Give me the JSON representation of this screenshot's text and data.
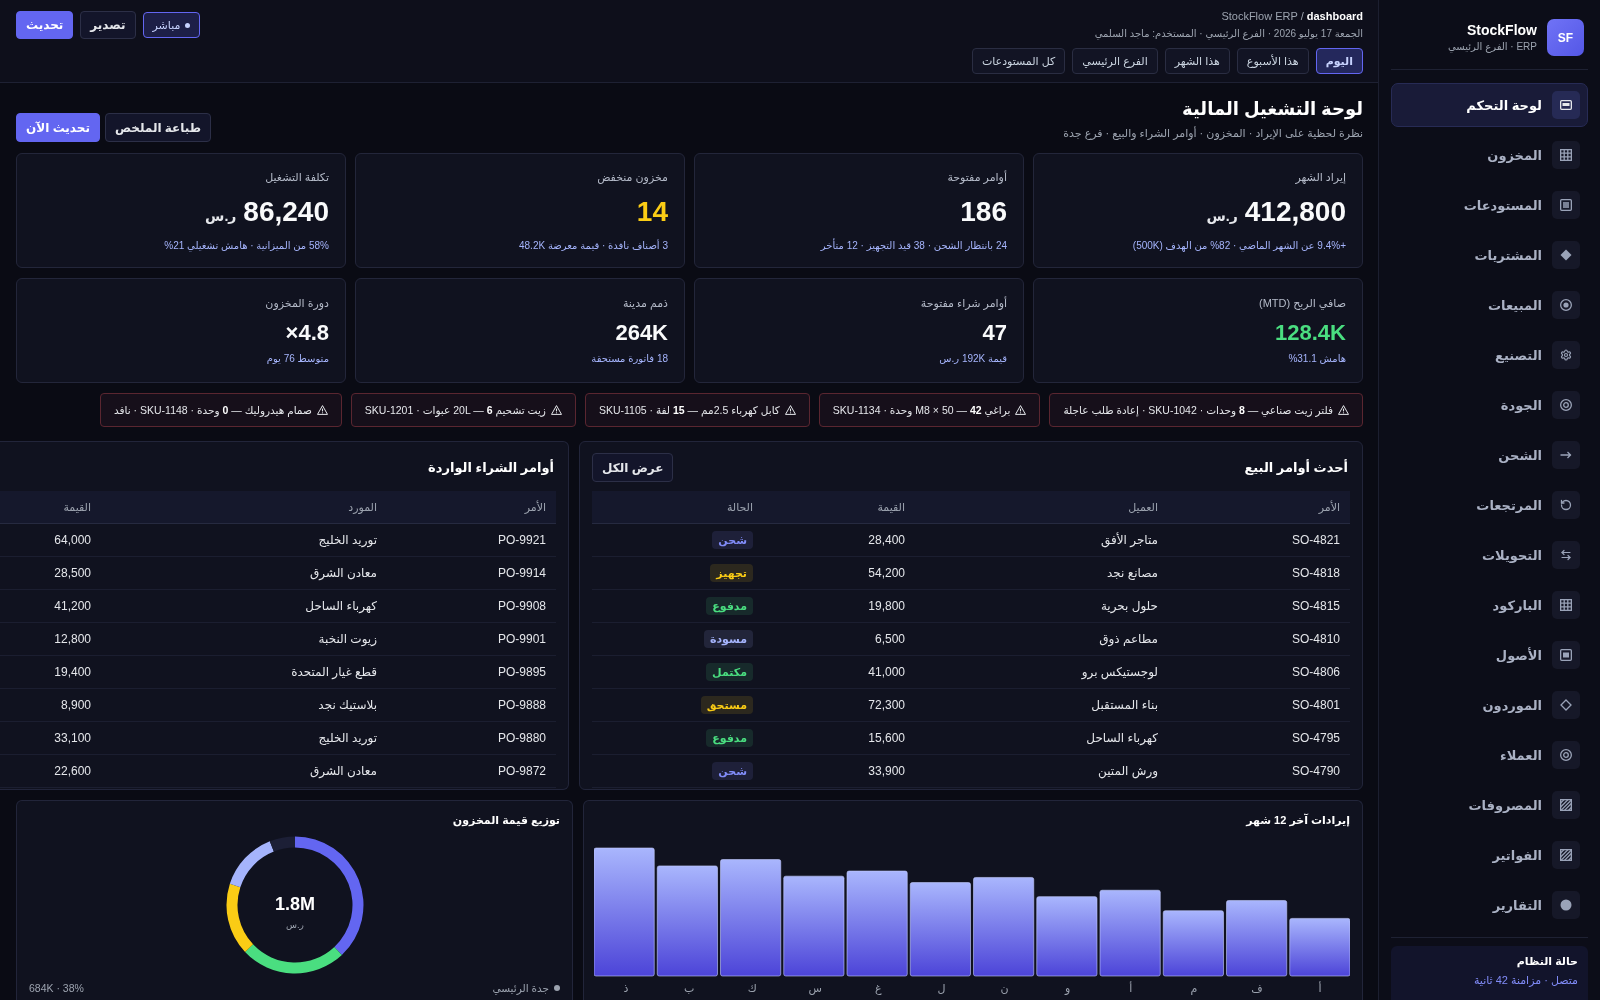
{
  "sidebar": {
    "logo": "SF",
    "brand": "StockFlow",
    "subtitle": "ERP · الفرع الرئيسي",
    "items": [
      {
        "label": "لوحة التحكم",
        "selected": true
      },
      {
        "label": "المخزون",
        "selected": false
      },
      {
        "label": "المستودعات",
        "selected": false
      },
      {
        "label": "المشتريات",
        "selected": false
      },
      {
        "label": "المبيعات",
        "selected": false
      },
      {
        "label": "التصنيع",
        "selected": false
      },
      {
        "label": "الجودة",
        "selected": false
      },
      {
        "label": "الشحن",
        "selected": false
      },
      {
        "label": "المرتجعات",
        "selected": false
      },
      {
        "label": "التحويلات",
        "selected": false
      },
      {
        "label": "الباركود",
        "selected": false
      },
      {
        "label": "الأصول",
        "selected": false
      },
      {
        "label": "الموردون",
        "selected": false
      },
      {
        "label": "العملاء",
        "selected": false
      },
      {
        "label": "المصروفات",
        "selected": false
      },
      {
        "label": "الفواتير",
        "selected": false
      },
      {
        "label": "التقارير",
        "selected": false
      }
    ],
    "status": {
      "title": "حالة النظام",
      "text": "متصل · مزامنة 42 ثانية"
    }
  },
  "header": {
    "breadcrumb": "StockFlow ERP / **dashboard**",
    "meta": "الجمعة 17 يوليو 2026 · الفرع الرئيسي · المستخدم: ماجد السلمي",
    "filters": [
      {
        "label": "اليوم",
        "selected": true
      },
      {
        "label": "هذا الأسبوع",
        "selected": false
      },
      {
        "label": "هذا الشهر",
        "selected": false
      },
      {
        "label": "الفرع الرئيسي",
        "selected": false
      },
      {
        "label": "كل المستودعات",
        "selected": false
      }
    ],
    "live_badge": "مباشر",
    "actions": [
      {
        "label": "تصدير",
        "kind": "secondary"
      },
      {
        "label": "تحديث",
        "kind": "primary"
      }
    ]
  },
  "page": {
    "title": "لوحة التشغيل المالية",
    "subtitle": "نظرة لحظية على الإيراد · المخزون · أوامر الشراء والبيع · فرع جدة",
    "actions": [
      {
        "label": "طباعة الملخص",
        "kind": "secondary"
      },
      {
        "label": "تحديث الآن",
        "kind": "primary"
      }
    ]
  },
  "kpis": [
    {
      "kind": "primary",
      "label": "إيراد الشهر",
      "value": "412,800",
      "unit": "ر.س",
      "color": "#f9fafb",
      "note": "+9.4% عن الشهر الماضي · 82% من الهدف (500K)"
    },
    {
      "kind": "primary",
      "label": "أوامر مفتوحة",
      "value": "186",
      "color": "#f9fafb",
      "note": "24 بانتظار الشحن · 38 قيد التجهيز · 12 متأخر"
    },
    {
      "kind": "primary",
      "label": "مخزون منخفض",
      "value": "14",
      "color": "#facc15",
      "note": "3 أصناف نافدة · قيمة معرضة 48.2K"
    },
    {
      "kind": "primary",
      "label": "تكلفة التشغيل",
      "value": "86,240",
      "unit": "ر.س",
      "color": "#f9fafb",
      "note": "58% من الميزانية · هامش تشغيلي 21%"
    },
    {
      "kind": "compact",
      "label": "صافي الربح (MTD)",
      "value": "128.4K",
      "color": "#4ade80",
      "note": "هامش 31.1%"
    },
    {
      "kind": "compact",
      "label": "أوامر شراء مفتوحة",
      "value": "47",
      "color": "#f9fafb",
      "note": "قيمة 192K ر.س"
    },
    {
      "kind": "compact",
      "label": "ذمم مدينة",
      "value": "264K",
      "color": "#f9fafb",
      "note": "18 فاتورة مستحقة"
    },
    {
      "kind": "compact",
      "label": "دورة المخزون",
      "value": "4.8×",
      "color": "#f9fafb",
      "note": "متوسط 76 يوم"
    }
  ],
  "alerts": [
    "فلتر زيت صناعي — **8** وحدات · SKU-1042 · إعادة طلب عاجلة",
    "براغي M8 × 50 — **42** وحدة · SKU-1134",
    "كابل كهرباء 2.5مم — **15** لفة · SKU-1105",
    "زيت تشحيم 20L — **6** عبوات · SKU-1201",
    "صمام هيدروليك — **0** وحدة · SKU-1148 · نافد"
  ],
  "sales_orders": {
    "title": "أحدث أوامر البيع",
    "button": "عرض الكل",
    "columns": [
      "الأمر",
      "العميل",
      "القيمة",
      "الحالة"
    ],
    "rows": [
      {
        "order": "SO-4821",
        "customer": "متاجر الأفق",
        "value": "28,400",
        "status": "شحن",
        "color": "#818cf8"
      },
      {
        "order": "SO-4818",
        "customer": "مصانع نجد",
        "value": "54,200",
        "status": "تجهيز",
        "color": "#facc15"
      },
      {
        "order": "SO-4815",
        "customer": "حلول بحرية",
        "value": "19,800",
        "status": "مدفوع",
        "color": "#4ade80"
      },
      {
        "order": "SO-4810",
        "customer": "مطاعم ذوق",
        "value": "6,500",
        "status": "مسودة",
        "color": "#a5b4fc"
      },
      {
        "order": "SO-4806",
        "customer": "لوجستيكس برو",
        "value": "41,000",
        "status": "مكتمل",
        "color": "#4ade80"
      },
      {
        "order": "SO-4801",
        "customer": "بناء المستقبل",
        "value": "72,300",
        "status": "مستحق",
        "color": "#facc15"
      },
      {
        "order": "SO-4795",
        "customer": "كهرباء الساحل",
        "value": "15,600",
        "status": "مدفوع",
        "color": "#4ade80"
      },
      {
        "order": "SO-4790",
        "customer": "ورش المتين",
        "value": "33,900",
        "status": "شحن",
        "color": "#818cf8"
      }
    ]
  },
  "purchase_orders": {
    "title": "أوامر الشراء الواردة",
    "columns": [
      "الأمر",
      "المورد",
      "القيمة"
    ],
    "rows": [
      {
        "order": "PO-9921",
        "supplier": "توريد الخليج",
        "value": "64,000"
      },
      {
        "order": "PO-9914",
        "supplier": "معادن الشرق",
        "value": "28,500"
      },
      {
        "order": "PO-9908",
        "supplier": "كهرباء الساحل",
        "value": "41,200"
      },
      {
        "order": "PO-9901",
        "supplier": "زيوت النخبة",
        "value": "12,800"
      },
      {
        "order": "PO-9895",
        "supplier": "قطع غيار المتحدة",
        "value": "19,400"
      },
      {
        "order": "PO-9888",
        "supplier": "بلاستيك نجد",
        "value": "8,900"
      },
      {
        "order": "PO-9880",
        "supplier": "توريد الخليج",
        "value": "33,100"
      },
      {
        "order": "PO-9872",
        "supplier": "معادن الشرق",
        "value": "22,600"
      }
    ]
  },
  "revenue": {
    "title": "إيرادات آخر 12 شهر",
    "month_labels": [
      "أ",
      "ف",
      "م",
      "أ",
      "و",
      "ن",
      "ل",
      "غ",
      "س",
      "ك",
      "ب",
      "ذ"
    ]
  },
  "inventory": {
    "chart_data": {
      "type": "donut",
      "title": "توزيع قيمة المخزون",
      "values": [
        38,
        25,
        17,
        14,
        6
      ]
    },
    "center_value": "1.8M",
    "center_unit": "ر.س",
    "legend": [
      {
        "name": "جدة الرئيسي",
        "reading": "684K · 38%",
        "color": "#9ca3af"
      }
    ]
  }
}
